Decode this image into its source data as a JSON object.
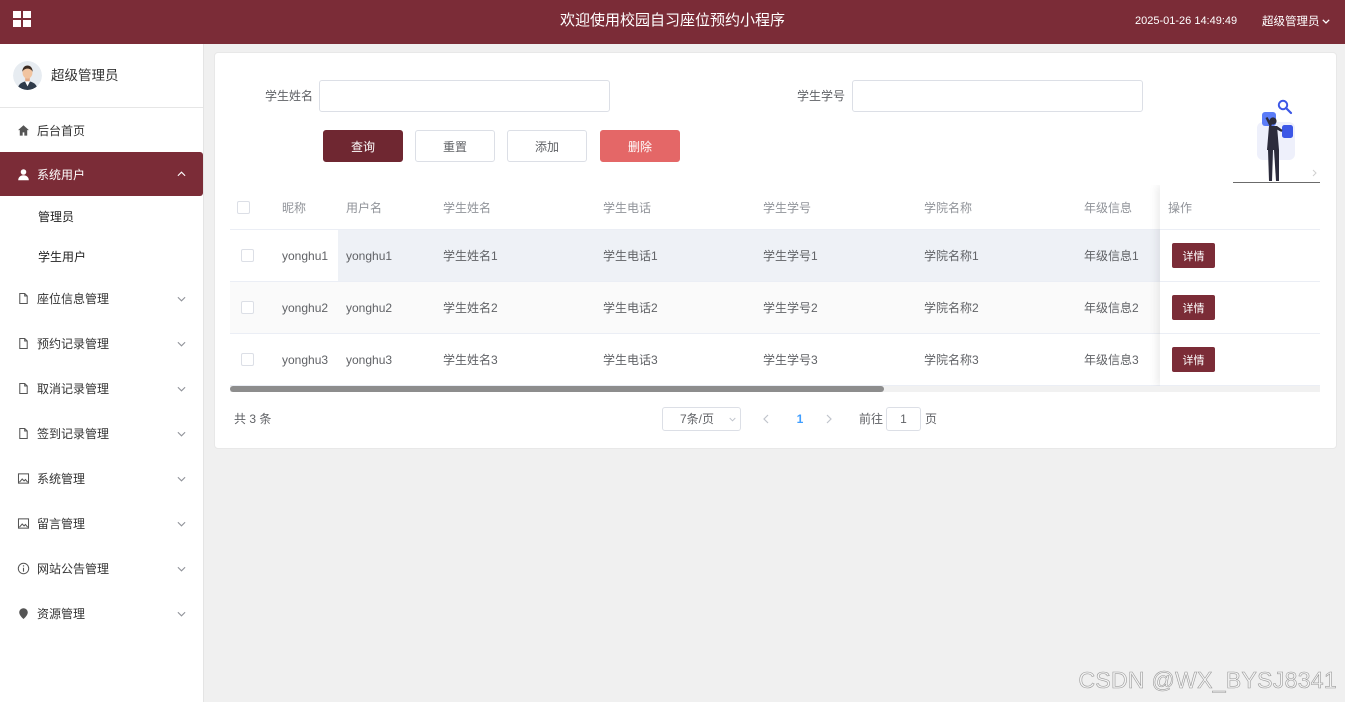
{
  "header": {
    "title": "欢迎使用校园自习座位预约小程序",
    "datetime": "2025-01-26 14:49:49",
    "user": "超级管理员",
    "menu_icon": "grid-icon",
    "user_dropdown_icon": "chevron-down-icon"
  },
  "colors": {
    "primary": "#7b2c37",
    "query_button": "#6f2731",
    "danger": "#e46767",
    "active_page": "#409eff",
    "page_background": "#f0f0f0"
  },
  "sidebar": {
    "profile": {
      "name": "超级管理员",
      "avatar_icon": "avatar-icon"
    },
    "menu": [
      {
        "label": "后台首页",
        "icon": "home-icon"
      },
      {
        "label": "系统用户",
        "icon": "user-icon",
        "active": true,
        "expanded": true,
        "children": [
          {
            "label": "管理员"
          },
          {
            "label": "学生用户"
          }
        ]
      },
      {
        "label": "座位信息管理",
        "icon": "document-icon"
      },
      {
        "label": "预约记录管理",
        "icon": "document-icon"
      },
      {
        "label": "取消记录管理",
        "icon": "document-icon"
      },
      {
        "label": "签到记录管理",
        "icon": "document-icon"
      },
      {
        "label": "系统管理",
        "icon": "picture-icon"
      },
      {
        "label": "留言管理",
        "icon": "picture-icon"
      },
      {
        "label": "网站公告管理",
        "icon": "info-icon"
      },
      {
        "label": "资源管理",
        "icon": "location-icon"
      }
    ]
  },
  "search": {
    "fields": [
      {
        "label": "学生姓名"
      },
      {
        "label": "学生学号"
      }
    ],
    "buttons": {
      "query": "查询",
      "reset": "重置",
      "add": "添加",
      "delete": "删除"
    },
    "illustration_icon": "search-illustration"
  },
  "table": {
    "columns": [
      "昵称",
      "用户名",
      "学生姓名",
      "学生电话",
      "学生学号",
      "学院名称",
      "年级信息",
      "操作"
    ],
    "rows": [
      {
        "nickname": "yonghu1",
        "username": "yonghu1",
        "name": "学生姓名1",
        "phone": "学生电话1",
        "student_no": "学生学号1",
        "college": "学院名称1",
        "grade": "年级信息1",
        "action": "详情"
      },
      {
        "nickname": "yonghu2",
        "username": "yonghu2",
        "name": "学生姓名2",
        "phone": "学生电话2",
        "student_no": "学生学号2",
        "college": "学院名称2",
        "grade": "年级信息2",
        "action": "详情"
      },
      {
        "nickname": "yonghu3",
        "username": "yonghu3",
        "name": "学生姓名3",
        "phone": "学生电话3",
        "student_no": "学生学号3",
        "college": "学院名称3",
        "grade": "年级信息3",
        "action": "详情"
      }
    ],
    "scroll": {
      "visible_fraction": 0.6,
      "offset_fraction": 0
    }
  },
  "pagination": {
    "total_text": "共 3 条",
    "page_size": "7条/页",
    "current_page": "1",
    "goto_label": "前往",
    "goto_value": "1",
    "page_suffix": "页",
    "prev_icon": "chevron-left-icon",
    "next_icon": "chevron-right-icon"
  },
  "watermark": "CSDN @WX_BYSJ8341"
}
